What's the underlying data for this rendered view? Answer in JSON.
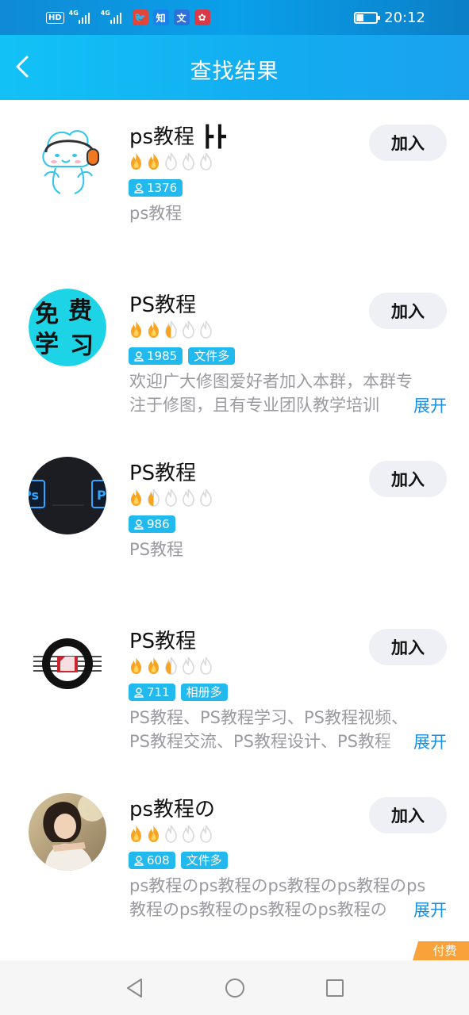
{
  "status_bar": {
    "network_badge": "HD",
    "signal1_label": "4G",
    "signal2_label": "4G",
    "app_icons": [
      {
        "name": "bird-app-icon",
        "glyph": "🐦",
        "color": "#e0463c"
      },
      {
        "name": "zhihu-app-icon",
        "glyph": "知",
        "color": "#1e80e8"
      },
      {
        "name": "text-app-icon",
        "glyph": "文",
        "color": "#2e6fd8"
      },
      {
        "name": "flower-app-icon",
        "glyph": "✿",
        "color": "#d83a47"
      }
    ],
    "time": "20:12"
  },
  "header": {
    "title": "查找结果",
    "back_icon": "chevron-left-icon"
  },
  "groups": [
    {
      "name": "ps教程 ┣┣",
      "flames": {
        "full": 2,
        "half": 0,
        "total": 5
      },
      "members": "1376",
      "badge": "",
      "desc_line1": "ps教程",
      "desc_line2": "",
      "expand": "",
      "join": "加入",
      "avatar": "cartoon"
    },
    {
      "name": "PS教程",
      "flames": {
        "full": 2,
        "half": 1,
        "total": 5
      },
      "members": "1985",
      "badge": "文件多",
      "desc_line1": "欢迎广大修图爱好者加入本群，本群专",
      "desc_line2": "注于修图，且有专业团队教学培训",
      "expand": "展开",
      "join": "加入",
      "avatar": "calligraphy"
    },
    {
      "name": "PS教程",
      "flames": {
        "full": 1,
        "half": 1,
        "total": 5
      },
      "members": "986",
      "badge": "",
      "desc_line1": "PS教程",
      "desc_line2": "",
      "expand": "",
      "join": "加入",
      "avatar": "photoshop"
    },
    {
      "name": "PS教程",
      "flames": {
        "full": 2,
        "half": 1,
        "total": 5
      },
      "members": "711",
      "badge": "相册多",
      "desc_line1": "PS教程、PS教程学习、PS教程视频、",
      "desc_line2": "PS教程交流、PS教程设计、PS教程",
      "expand": "展开",
      "join": "加入",
      "avatar": "graphic-design"
    },
    {
      "name": "ps教程の",
      "flames": {
        "full": 2,
        "half": 0,
        "total": 5
      },
      "members": "608",
      "badge": "文件多",
      "desc_line1": "ps教程のps教程のps教程のps教程のps",
      "desc_line2": "教程のps教程のps教程のps教程の",
      "expand": "展开",
      "join": "加入",
      "avatar": "photo-girl"
    }
  ],
  "paid_badge": "付费",
  "colors": {
    "accent": "#13b4f3",
    "tag": "#22b9ef",
    "flame": "#f7a422",
    "link": "#1a8fe0"
  }
}
